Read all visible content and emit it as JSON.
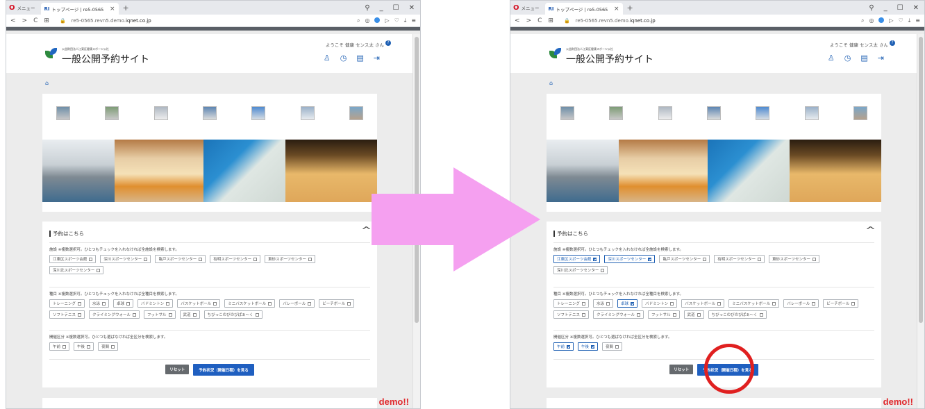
{
  "browser": {
    "menu_label": "メニュー",
    "tab_badge": "RI",
    "tab_title": "トップページ | re5-0565",
    "url_sub": "re5-0565.revn5.demo.",
    "url_main": "iqnet.co.jp"
  },
  "site": {
    "org_name": "公益財団法人江東区健康スポーツ公社",
    "title": "一般公開予約サイト",
    "welcome": "ようこそ 健康 センス太 さん"
  },
  "search": {
    "section_title": "予約はこちら",
    "facility_label": "施設 ※複数選択可。ひとつもチェックを入れなければ全施設を検索します。",
    "facilities": [
      "江東区スポーツ会館",
      "深川スポーツセンター",
      "亀戸スポーツセンター",
      "有明スポーツセンター",
      "東砂スポーツセンター",
      "深川北スポーツセンター"
    ],
    "category_label": "種目 ※複数選択可。ひとつもチェックを入れなければ全種目を検索します。",
    "categories": [
      "トレーニング",
      "水泳",
      "卓球",
      "バドミントン",
      "バスケットボール",
      "ミニバスケットボール",
      "バレーボール",
      "ビーチボール",
      "ソフトテニス",
      "クライミングウォール",
      "フットサル",
      "武道",
      "ちびっこのびのびぱぁ〜く"
    ],
    "timeslot_label": "開催区分 ※複数選択可。ひとつも選ばなければ全区分を検索します。",
    "timeslots": [
      "午前",
      "午後",
      "夜間"
    ],
    "reset_label": "リセット",
    "view_label": "予約状況（開催日程）を見る"
  },
  "before": {
    "facilities_checked": [],
    "categories_checked": [],
    "timeslots_checked": []
  },
  "after": {
    "facilities_checked": [
      "江東区スポーツ会館",
      "深川スポーツセンター"
    ],
    "categories_checked": [
      "卓球"
    ],
    "timeslots_checked": [
      "午前",
      "午後"
    ]
  },
  "demo_label": "demo!!",
  "colors": {
    "accent": "#1f5fc0",
    "arrow": "#f5a0f0",
    "circle": "#e02020",
    "demo": "#e0282c"
  }
}
